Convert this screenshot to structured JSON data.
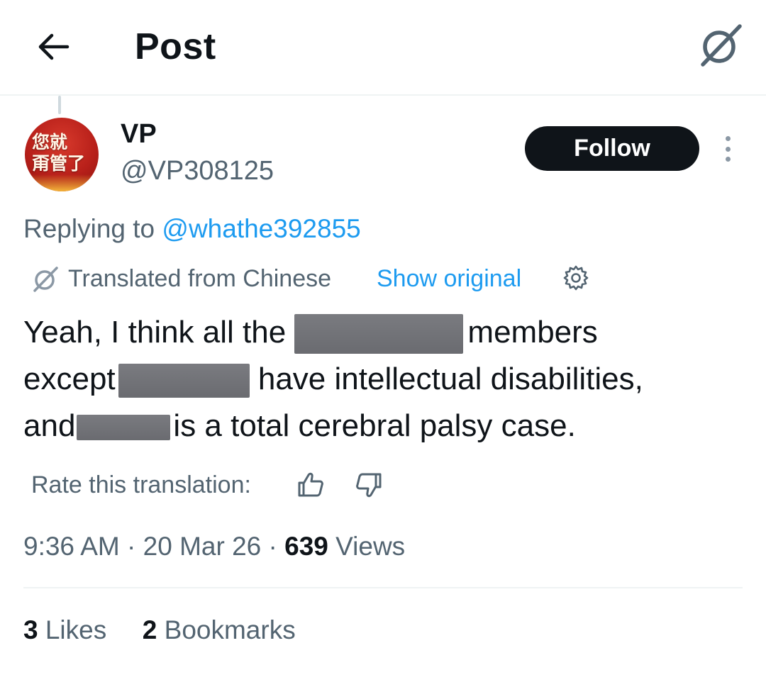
{
  "header": {
    "title": "Post",
    "back_icon": "arrow-left-icon",
    "grok_icon": "grok-icon"
  },
  "author": {
    "display_name": "VP",
    "handle": "@VP308125",
    "avatar_text": "您就\n甭管了",
    "follow_label": "Follow"
  },
  "reply": {
    "prefix": "Replying to ",
    "target": "@whathe392855"
  },
  "translation": {
    "label": "Translated from Chinese",
    "show_original": "Show original"
  },
  "body": {
    "line1_a": "Yeah, I think all the ",
    "line1_b": "members",
    "line2_a": "except",
    "line2_b": " have intellectual disabilities,",
    "line3_a": "and",
    "line3_b": "is a total cerebral palsy case."
  },
  "rate": {
    "label": "Rate this translation:"
  },
  "meta": {
    "time": "9:36 AM",
    "sep1": " · ",
    "date": "20 Mar 26",
    "sep2": " · ",
    "views_count": "639",
    "views_label": " Views"
  },
  "stats": {
    "likes_count": "3",
    "likes_label": " Likes",
    "bookmarks_count": "2",
    "bookmarks_label": " Bookmarks"
  },
  "colors": {
    "link": "#1d9bf0",
    "secondary": "#536471",
    "primary": "#0f1419"
  }
}
